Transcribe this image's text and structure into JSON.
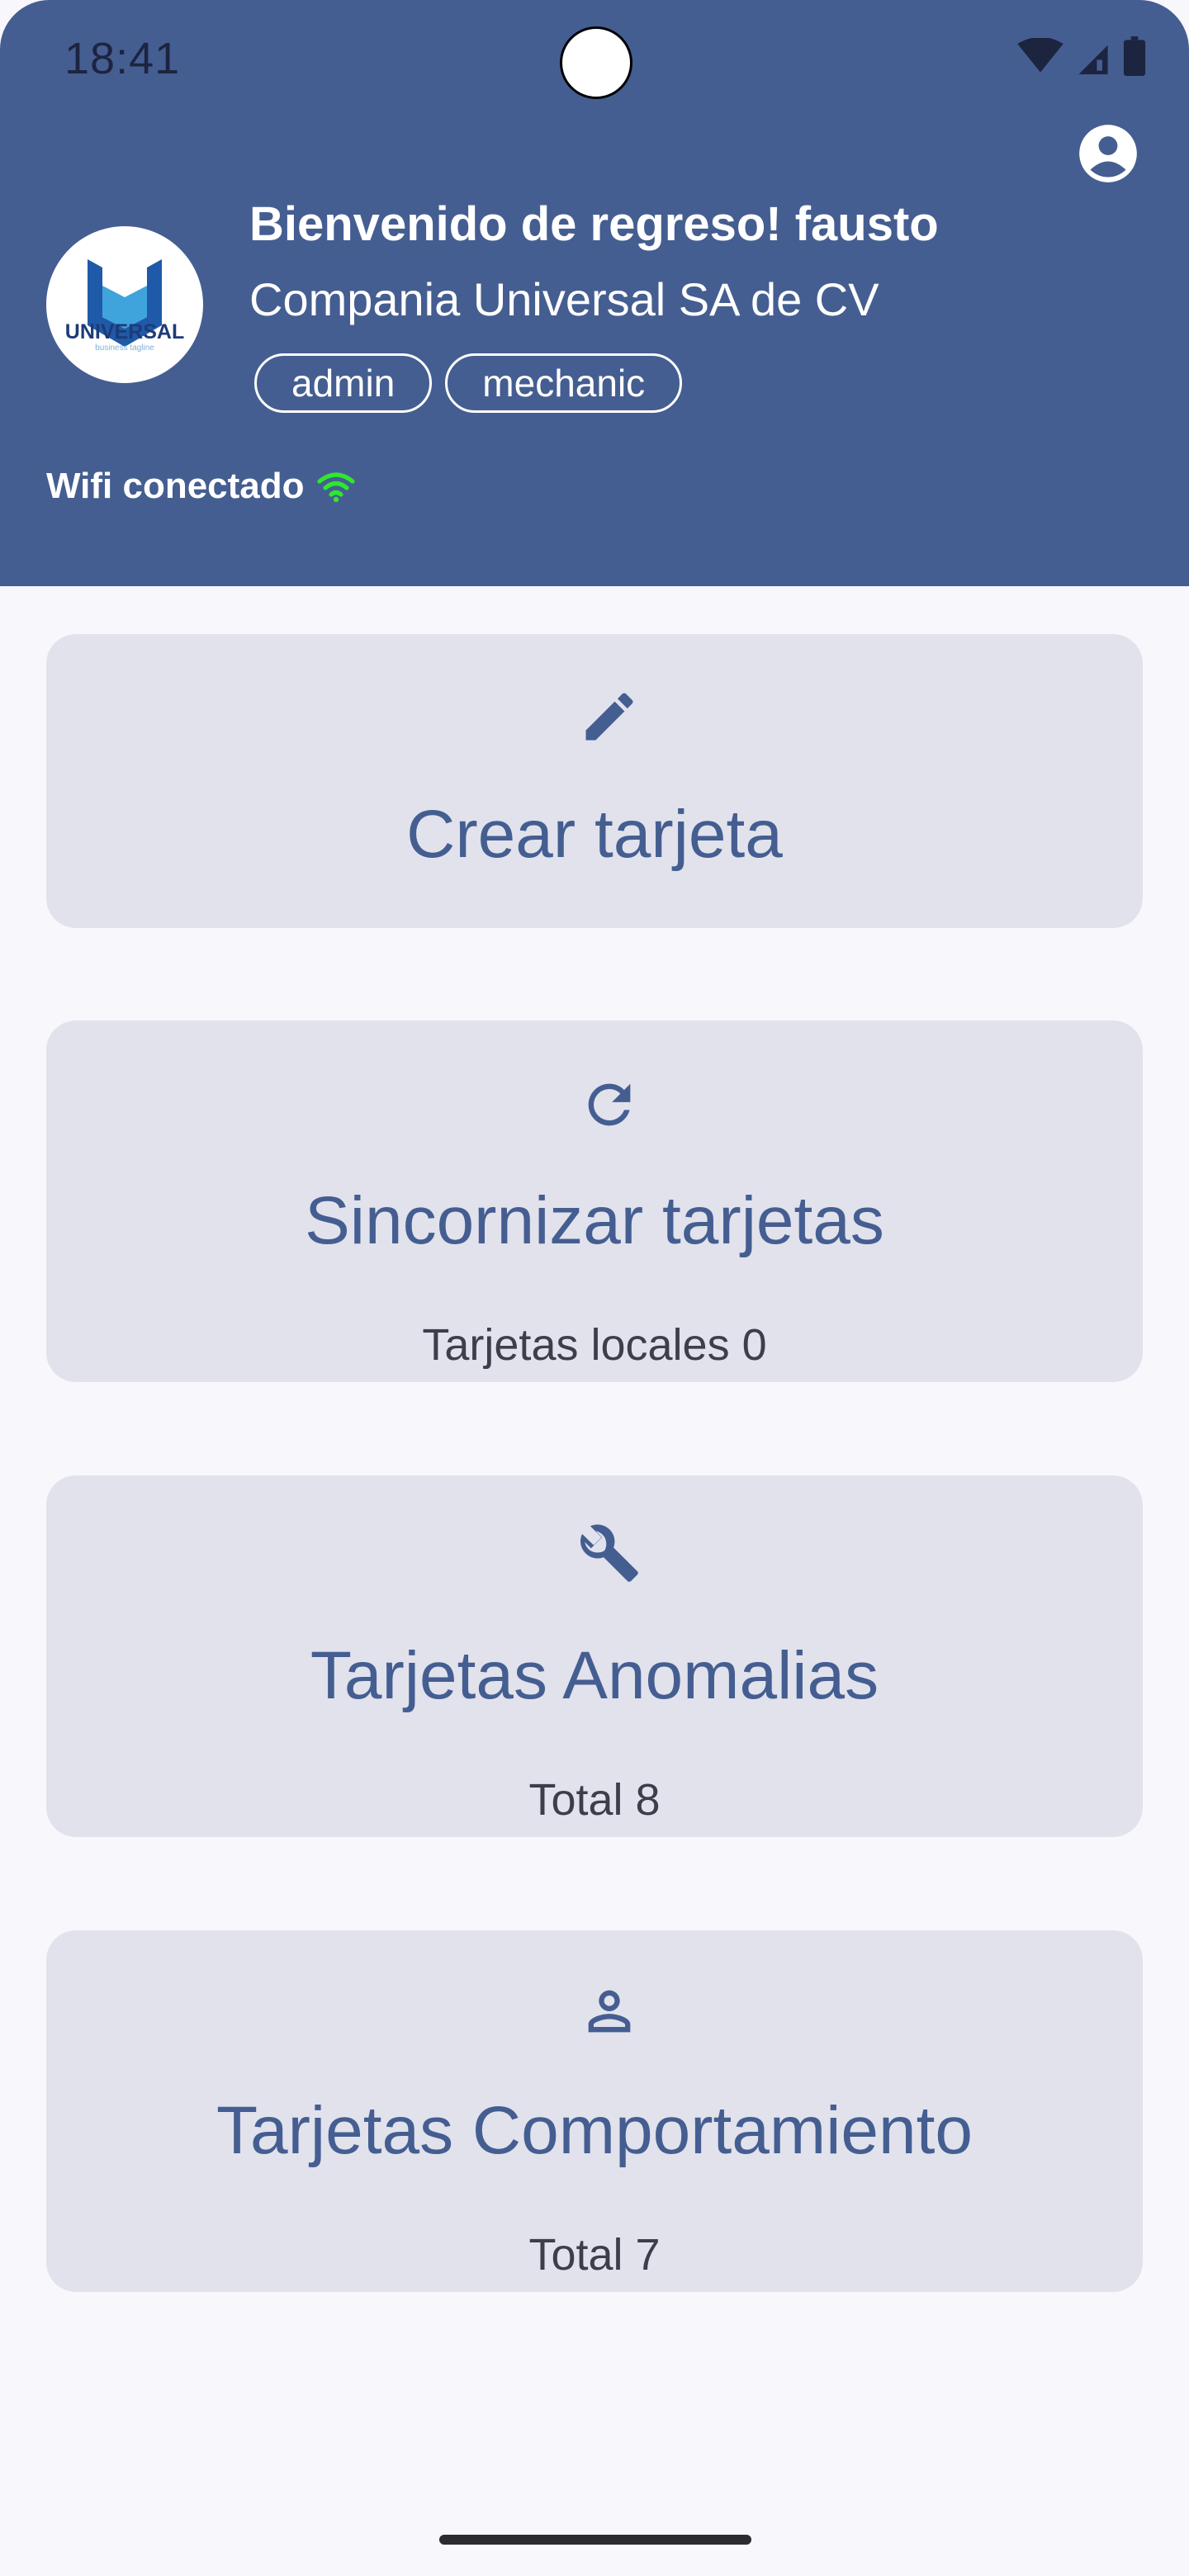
{
  "status_bar": {
    "time": "18:41"
  },
  "header": {
    "welcome": "Bienvenido de regreso! fausto",
    "company": "Compania Universal SA de CV",
    "roles": [
      "admin",
      "mechanic"
    ],
    "wifi_status": "Wifi conectado",
    "logo": {
      "name": "UNIVERSAL",
      "tagline": "business tagline"
    }
  },
  "cards": [
    {
      "icon": "pencil-icon",
      "title": "Crear tarjeta"
    },
    {
      "icon": "refresh-icon",
      "title": "Sincornizar tarjetas",
      "subtitle": "Tarjetas locales 0"
    },
    {
      "icon": "wrench-icon",
      "title": "Tarjetas Anomalias",
      "subtitle": "Total 8"
    },
    {
      "icon": "person-icon",
      "title": "Tarjetas Comportamiento",
      "subtitle": "Total 7"
    }
  ],
  "colors": {
    "primary": "#455e91",
    "card_bg": "#e1e2ec",
    "page_bg": "#f8f8fc",
    "wifi_ok": "#2ee82e"
  }
}
